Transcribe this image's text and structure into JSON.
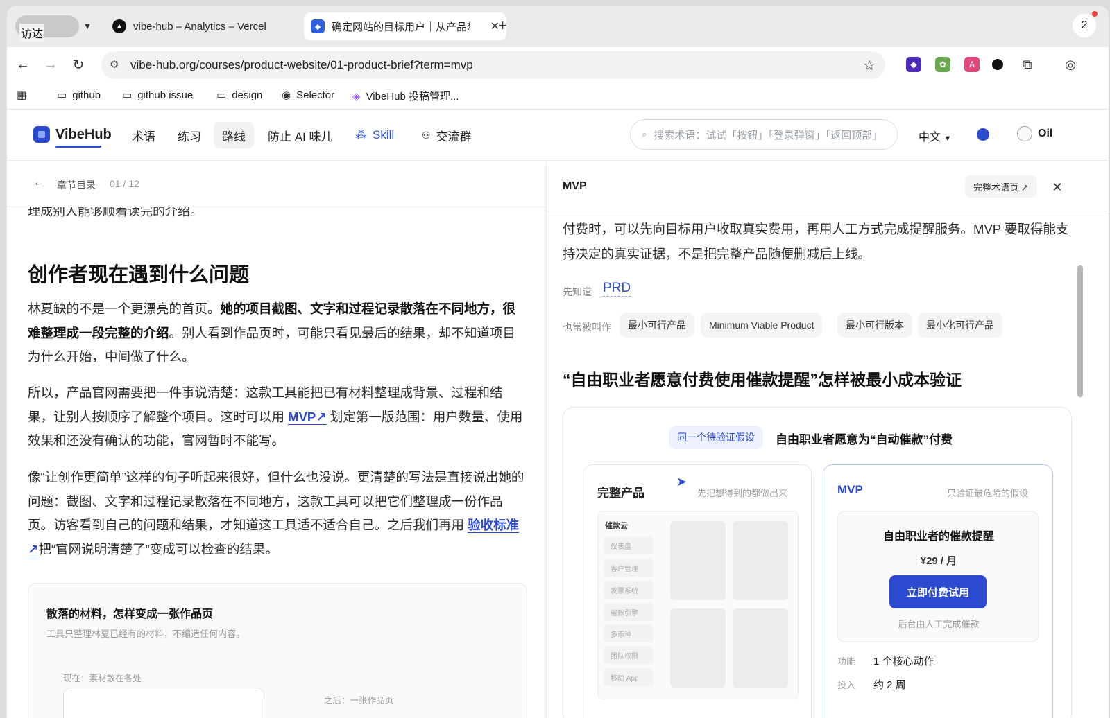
{
  "browser": {
    "finder_label": "访达",
    "tabs": [
      {
        "title": "vibe-hub – Analytics – Vercel"
      },
      {
        "title": "确定网站的目标用户｜从产品想"
      }
    ],
    "notification_count": "2",
    "url": "vibe-hub.org/courses/product-website/01-product-brief?term=mvp",
    "bookmarks": [
      "github",
      "github issue",
      "design",
      "Selector",
      "VibeHub 投稿管理..."
    ]
  },
  "site": {
    "logo": "VibeHub",
    "nav": [
      "术语",
      "练习",
      "路线",
      "防止 AI 味儿",
      "Skill",
      "交流群"
    ],
    "active_nav": "路线",
    "search_placeholder": "搜索术语：试试「按钮」「登录弹窗」「返回顶部」",
    "language": "中文",
    "user": "Oil"
  },
  "article": {
    "chapter_label": "章节目录",
    "chapter_count": "01 / 12",
    "cut_text": "理成别人能够顺着读完的介绍。",
    "heading": "创作者现在遇到什么问题",
    "p1_a": "林夏缺的不是一个更漂亮的首页。",
    "p1_b": "她的项目截图、文字和过程记录散落在不同地方，很难整理成一段完整的介绍",
    "p1_c": "。别人看到作品页时，可能只看见最后的结果，却不知道项目为什么开始，中间做了什么。",
    "p2_a": "所以，产品官网需要把一件事说清楚：这款工具能把已有材料整理成背景、过程和结果，让别人按顺序了解整个项目。这时可以用 ",
    "p2_term": "MVP↗",
    "p2_b": " 划定第一版范围：用户数量、使用效果和还没有确认的功能，官网暂时不能写。",
    "p3_a": "像“让创作更简单”这样的句子听起来很好，但什么也没说。更清楚的写法是直接说出她的问题：截图、文字和过程记录散落在不同地方，这款工具可以把它们整理成一份作品页。访客看到自己的问题和结果，才知道这工具适不适合自己。之后我们再用 ",
    "p3_term": "验收标准↗",
    "p3_b": "把“官网说明清楚了”变成可以检查的结果。",
    "card_title": "散落的材料，怎样变成一张作品页",
    "card_sub": "工具只整理林夏已经有的材料，不编造任何内容。",
    "card_now": "现在：素材散在各处",
    "card_after": "之后：一张作品页"
  },
  "glossary": {
    "term": "MVP",
    "full_page": "完整术语页 ↗",
    "text": "付费时，可以先向目标用户收取真实费用，再用人工方式完成提醒服务。MVP 要取得能支持决定的真实证据，不是把完整产品随便删减后上线。",
    "prereq_label": "先知道",
    "prereq": "PRD",
    "aka_label": "也常被叫作",
    "aliases": [
      "最小可行产品",
      "Minimum Viable Product",
      "最小可行版本",
      "最小化可行产品"
    ],
    "example_heading": "“自由职业者愿意付费使用催款提醒”怎样被最小成本验证",
    "hypothesis_badge": "同一个待验证假设",
    "hypothesis": "自由职业者愿意为“自动催款”付费",
    "full_product": {
      "title": "完整产品",
      "note": "先把想得到的都做出来",
      "brand": "催款云",
      "menu": [
        "仪表盘",
        "客户管理",
        "发票系统",
        "催款引擎",
        "多币种",
        "团队权限",
        "移动 App"
      ]
    },
    "mvp": {
      "title": "MVP",
      "note": "只验证最危险的假设",
      "product": "自由职业者的催款提醒",
      "price": "¥29 / 月",
      "cta": "立即付费试用",
      "backend": "后台由人工完成催款",
      "rows": [
        {
          "k": "功能",
          "v": "1 个核心动作"
        },
        {
          "k": "投入",
          "v": "约 2 周"
        }
      ]
    }
  }
}
